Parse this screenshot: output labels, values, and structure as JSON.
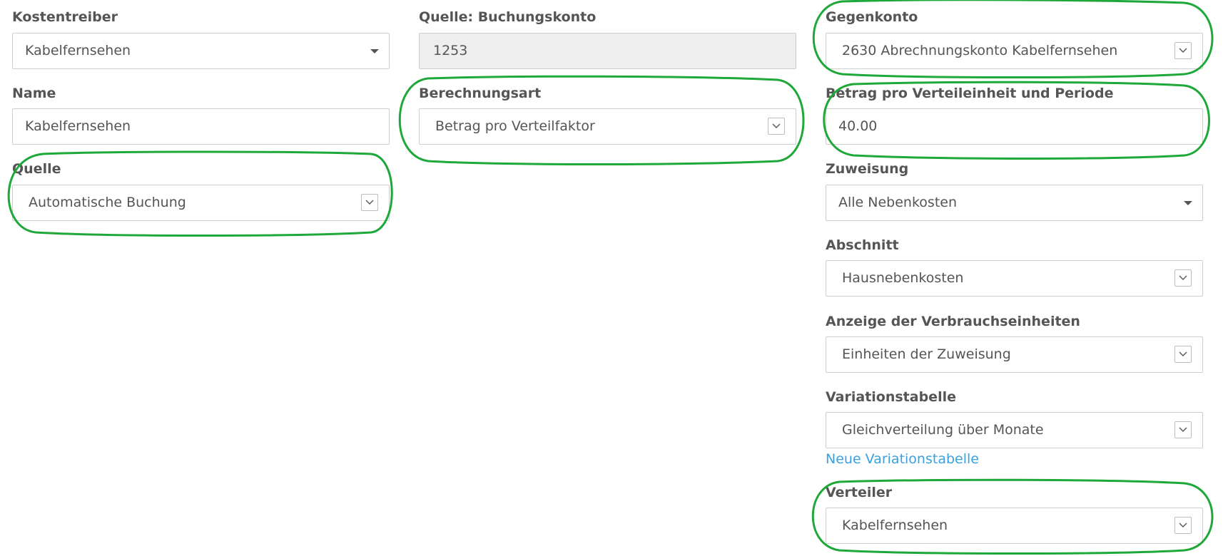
{
  "col1": {
    "kostentreiber": {
      "label": "Kostentreiber",
      "value": "Kabelfernsehen"
    },
    "name": {
      "label": "Name",
      "value": "Kabelfernsehen"
    },
    "quelle": {
      "label": "Quelle",
      "value": "Automatische Buchung"
    }
  },
  "col2": {
    "buchungskonto": {
      "label": "Quelle: Buchungskonto",
      "value": "1253"
    },
    "berechnungsart": {
      "label": "Berechnungsart",
      "value": "Betrag pro Verteilfaktor"
    }
  },
  "col3": {
    "gegenkonto": {
      "label": "Gegenkonto",
      "value": "2630 Abrechnungskonto Kabelfernsehen"
    },
    "betrag": {
      "label": "Betrag pro Verteileinheit und Periode",
      "value": "40.00"
    },
    "zuweisung": {
      "label": "Zuweisung",
      "value": "Alle Nebenkosten"
    },
    "abschnitt": {
      "label": "Abschnitt",
      "value": "Hausnebenkosten"
    },
    "anzeige": {
      "label": "Anzeige der Verbrauchseinheiten",
      "value": "Einheiten der Zuweisung"
    },
    "variationstabelle": {
      "label": "Variationstabelle",
      "value": "Gleichverteilung über Monate",
      "link": "Neue Variationstabelle"
    },
    "verteiler": {
      "label": "Verteiler",
      "value": "Kabelfernsehen"
    }
  },
  "colors": {
    "highlight": "#1fa83a",
    "link": "#3aa0e0"
  }
}
